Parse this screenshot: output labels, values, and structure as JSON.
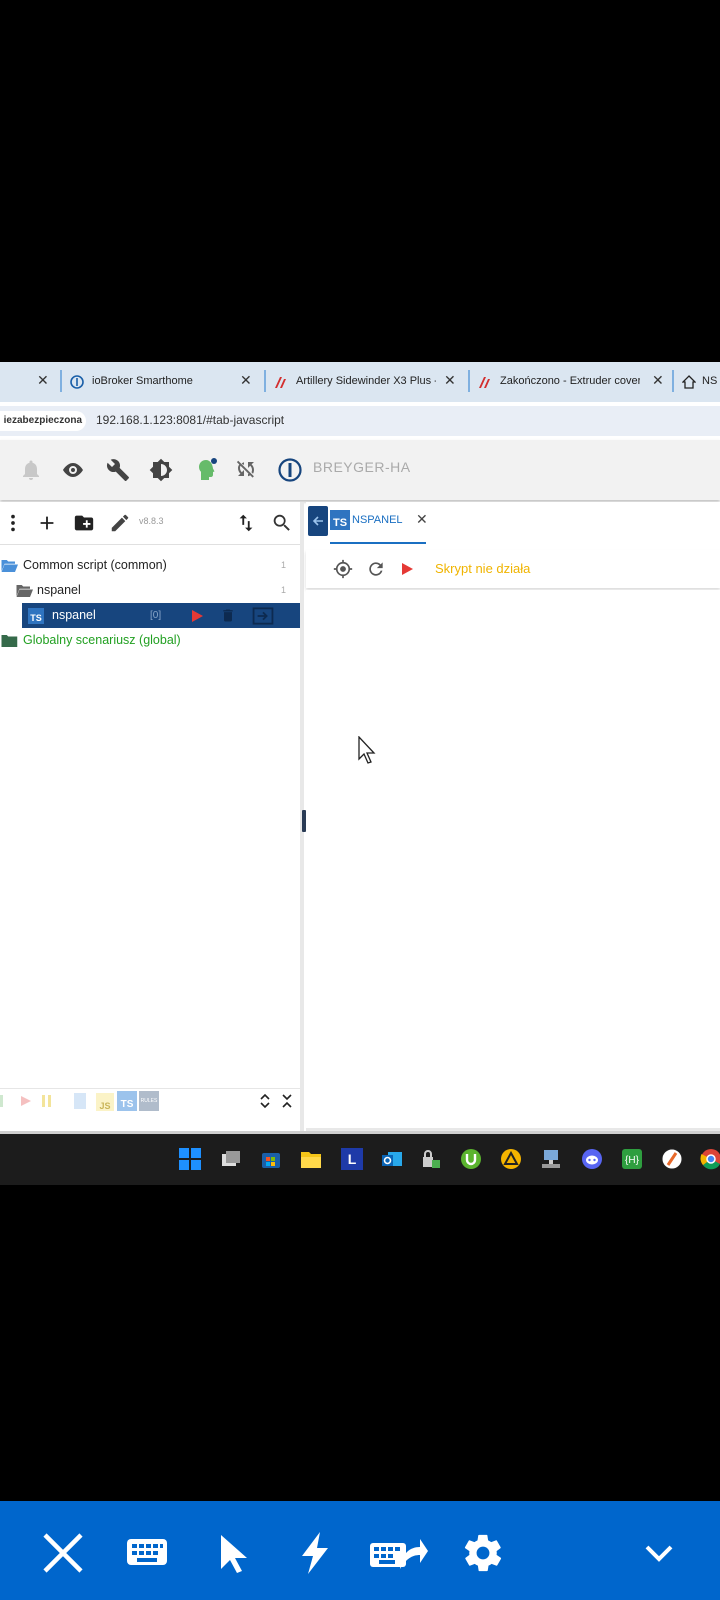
{
  "browser": {
    "tabs": [
      {
        "label": "ioBroker Smarthome",
        "icon": "iobroker-logo-icon"
      },
      {
        "label": "Artillery Sidewinder X3 Plus -",
        "icon": "artillery-logo-icon"
      },
      {
        "label": "Zakończono - Extruder cover",
        "icon": "artillery-logo-icon"
      },
      {
        "label": "NS",
        "icon": "house-logo-icon"
      }
    ],
    "security_label": "iezabezpieczona",
    "url": "192.168.1.123:8081/#tab-javascript"
  },
  "app_header": {
    "brand": "BREYGER-HA",
    "icons": [
      "bell-icon",
      "eye-icon",
      "wrench-icon",
      "brightness-icon",
      "user-head-icon",
      "sync-disabled-icon",
      "iobroker-logo-icon"
    ]
  },
  "script_tree": {
    "version": "v8.8.3",
    "items": [
      {
        "label": "Common script (common)",
        "count": "1"
      },
      {
        "label": "nspanel",
        "count": "1"
      },
      {
        "label": "nspanel",
        "count": "[0]",
        "type": "TS"
      },
      {
        "label": "Globalny scenariusz (global)"
      }
    ],
    "filter_badges": [
      "JS",
      "TS",
      "RULES"
    ]
  },
  "editor": {
    "tab_label": "NSPANEL",
    "tab_badge": "TS",
    "status": "Skrypt nie działa"
  },
  "colors": {
    "selected_row": "#17457e",
    "global_folder_text": "#22a022",
    "status_text": "#f0b400",
    "control_bar": "#0066cc",
    "run_icon": "#e53935"
  },
  "control_bar": {
    "icons": [
      "close-icon",
      "keyboard-icon",
      "pointer-icon",
      "lightning-icon",
      "keyboard-send-icon",
      "gear-icon",
      "chevron-down-icon"
    ]
  }
}
